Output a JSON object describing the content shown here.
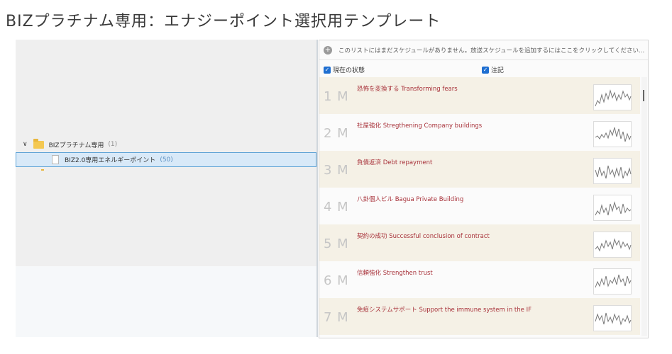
{
  "page": {
    "title": "BIZプラチナム専用：エナジーポイント選択用テンプレート"
  },
  "tree": {
    "parent": {
      "label": "BIZプラチナム専用",
      "count": "(1)",
      "icon": "folder-icon"
    },
    "child": {
      "label": "BIZ2.0専用エネルギーポイント",
      "count": "(50)",
      "icon": "file-icon"
    }
  },
  "list_panel": {
    "info_message": "このリストにはまだスケジュールがありません。放送スケジュールを追加するにはここをクリックしてください...",
    "columns": {
      "status": "現在の状態",
      "notes": "注記"
    },
    "items": [
      {
        "num": "1 M",
        "title": "恐怖を変換する Transforming fears"
      },
      {
        "num": "2 M",
        "title": "社屋強化 Stregthening Company buildings"
      },
      {
        "num": "3 M",
        "title": "負債返済 Debt repayment"
      },
      {
        "num": "4 M",
        "title": "八卦個人ビル Bagua Private Building"
      },
      {
        "num": "5 M",
        "title": "契約の成功 Successful conclusion of contract"
      },
      {
        "num": "6 M",
        "title": "信頼強化 Strengthen trust"
      },
      {
        "num": "7 M",
        "title": "免疫システムサポート Support the immune system in the IF"
      }
    ]
  },
  "colors": {
    "title_red": "#a8323a",
    "row_alt": "#f5f1e6",
    "selection": "#d8e9f8",
    "checkbox": "#1f6fd1"
  }
}
